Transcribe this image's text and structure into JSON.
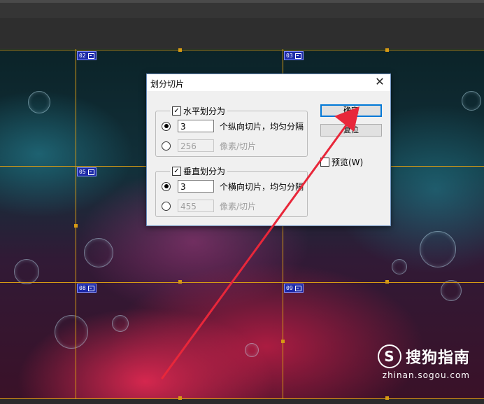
{
  "slices": [
    {
      "label": "02"
    },
    {
      "label": "03"
    },
    {
      "label": "05"
    },
    {
      "label": "08"
    },
    {
      "label": "09"
    }
  ],
  "dialog": {
    "title": "划分切片",
    "close_glyph": "✕",
    "horizontal": {
      "checkbox_label": "水平划分为",
      "checked": true,
      "count_value": "3",
      "count_label": "个纵向切片，均匀分隔",
      "pixels_value": "256",
      "pixels_label": "像素/切片"
    },
    "vertical": {
      "checkbox_label": "垂直划分为",
      "checked": true,
      "count_value": "3",
      "count_label": "个横向切片，均匀分隔",
      "pixels_value": "455",
      "pixels_label": "像素/切片"
    },
    "ok_label": "确定",
    "reset_label": "复位",
    "preview_label": "预览(W)",
    "check_glyph": "✓"
  },
  "watermark": {
    "brand": "搜狗指南",
    "url": "zhinan.sogou.com",
    "logo_glyph": "S"
  },
  "colors": {
    "guide": "#d69a14",
    "slice_badge": "#1d2aa8",
    "arrow": "#e8273a",
    "default_button_border": "#0078d7"
  },
  "icons": {
    "slice_image": "image-icon",
    "close": "close-icon",
    "check": "check-icon",
    "arrow": "annotation-arrow"
  }
}
